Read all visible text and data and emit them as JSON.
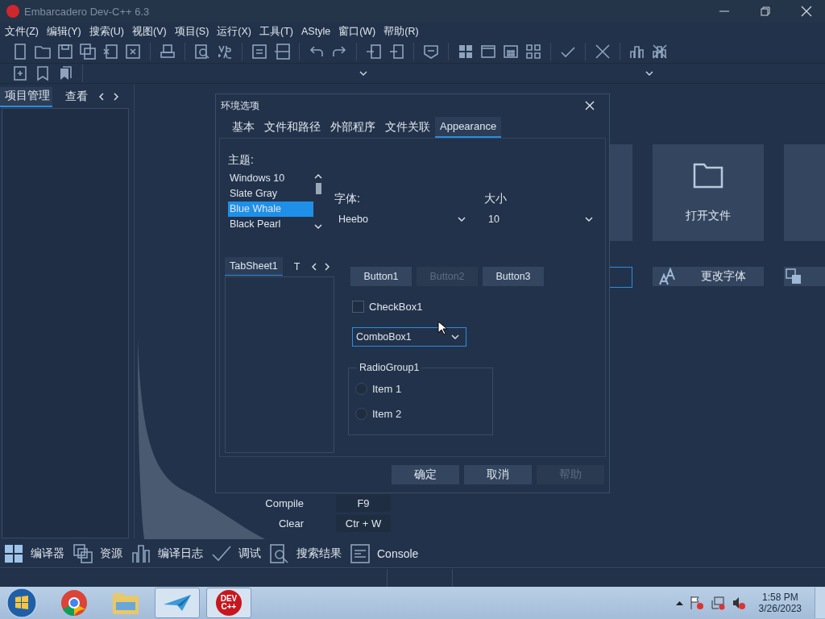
{
  "window": {
    "title": "Embarcadero Dev-C++ 6.3"
  },
  "menu": [
    "文件(Z)",
    "编辑(Y)",
    "搜索(U)",
    "视图(V)",
    "项目(S)",
    "运行(X)",
    "工具(T)",
    "AStyle",
    "窗口(W)",
    "帮助(R)"
  ],
  "left_panel": {
    "tabs": [
      {
        "label": "项目管理",
        "selected": true
      },
      {
        "label": "查看",
        "selected": false
      }
    ]
  },
  "welcome": {
    "cards": [
      {
        "label": "打开文件"
      }
    ],
    "actions": [
      {
        "label": "更改字体"
      }
    ],
    "shortcuts": [
      {
        "command": "Compile",
        "key": "F9"
      },
      {
        "command": "Clear",
        "key": "Ctr + W"
      }
    ]
  },
  "dialog": {
    "title": "环境选项",
    "tabs": [
      {
        "label": "基本",
        "selected": false
      },
      {
        "label": "文件和路径",
        "selected": false
      },
      {
        "label": "外部程序",
        "selected": false
      },
      {
        "label": "文件关联",
        "selected": false
      },
      {
        "label": "Appearance",
        "selected": true
      }
    ],
    "theme_label": "主题:",
    "themes": [
      {
        "label": "Windows 10",
        "selected": false
      },
      {
        "label": "Slate Gray",
        "selected": false
      },
      {
        "label": "Blue Whale",
        "selected": true
      },
      {
        "label": "Black Pearl",
        "selected": false
      }
    ],
    "font_label": "字体:",
    "font": "Heebo",
    "size_label": "大小",
    "size": "10",
    "preview": {
      "tabs": [
        {
          "label": "TabSheet1",
          "selected": true
        },
        {
          "label": "T",
          "selected": false
        }
      ],
      "buttons": [
        {
          "label": "Button1",
          "disabled": false
        },
        {
          "label": "Button2",
          "disabled": true
        },
        {
          "label": "Button3",
          "disabled": false
        }
      ],
      "checkbox": {
        "label": "CheckBox1",
        "checked": false
      },
      "combo": "ComboBox1",
      "radio_group": {
        "title": "RadioGroup1",
        "items": [
          {
            "label": "Item 1",
            "selected": false
          },
          {
            "label": "Item 2",
            "selected": false
          }
        ]
      }
    },
    "buttons": [
      {
        "label": "确定",
        "disabled": false
      },
      {
        "label": "取消",
        "disabled": false
      },
      {
        "label": "帮助",
        "disabled": true
      }
    ]
  },
  "bottom_tabs": [
    {
      "kind": "grid",
      "label": "编译器"
    },
    {
      "kind": "copy",
      "label": "资源"
    },
    {
      "kind": "chart",
      "label": "编译日志"
    },
    {
      "kind": "check",
      "label": "调试"
    },
    {
      "kind": "search",
      "label": "搜索结果"
    },
    {
      "kind": "console",
      "label": "Console"
    }
  ],
  "taskbar": {
    "apps": [
      {
        "kind": "browser",
        "running": false
      },
      {
        "kind": "folder",
        "running": false
      },
      {
        "kind": "plane",
        "running": true
      },
      {
        "kind": "dev",
        "running": true
      }
    ],
    "dev_logo": [
      "DEV",
      "C++"
    ],
    "time": "1:58 PM",
    "date": "3/26/2023"
  }
}
